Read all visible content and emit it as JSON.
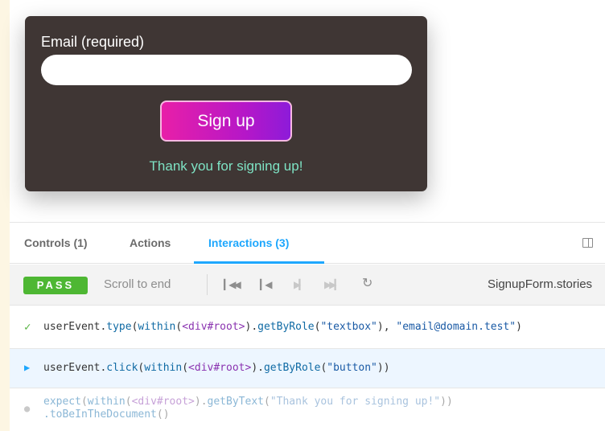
{
  "form": {
    "email_label": "Email (required)",
    "email_value": "",
    "submit_label": "Sign up",
    "success_message": "Thank you for signing up!"
  },
  "panel": {
    "tabs": [
      {
        "label": "Controls (1)",
        "active": false
      },
      {
        "label": "Actions",
        "active": false
      },
      {
        "label": "Interactions (3)",
        "active": true
      }
    ],
    "toggle_icon": "panel-layout-icon"
  },
  "toolbar": {
    "status": "PASS",
    "scroll_label": "Scroll to end",
    "controls": [
      "rewind-to-start-icon",
      "step-back-icon",
      "step-forward-icon",
      "skip-to-end-icon",
      "reload-icon"
    ],
    "story_file": "SignupForm.stories"
  },
  "interactions": [
    {
      "status": "done",
      "parts": [
        {
          "t": "userEvent.",
          "c": "plain"
        },
        {
          "t": "type",
          "c": "fn"
        },
        {
          "t": "(",
          "c": "plain"
        },
        {
          "t": "within",
          "c": "fn"
        },
        {
          "t": "(",
          "c": "plain"
        },
        {
          "t": "<div#root>",
          "c": "el"
        },
        {
          "t": ").",
          "c": "plain"
        },
        {
          "t": "getByRole",
          "c": "fn"
        },
        {
          "t": "(",
          "c": "plain"
        },
        {
          "t": "\"textbox\"",
          "c": "str"
        },
        {
          "t": "), ",
          "c": "plain"
        },
        {
          "t": "\"email@domain.test\"",
          "c": "str"
        },
        {
          "t": ")",
          "c": "plain"
        }
      ]
    },
    {
      "status": "active",
      "parts": [
        {
          "t": "userEvent.",
          "c": "plain"
        },
        {
          "t": "click",
          "c": "fn"
        },
        {
          "t": "(",
          "c": "plain"
        },
        {
          "t": "within",
          "c": "fn"
        },
        {
          "t": "(",
          "c": "plain"
        },
        {
          "t": "<div#root>",
          "c": "el"
        },
        {
          "t": ").",
          "c": "plain"
        },
        {
          "t": "getByRole",
          "c": "fn"
        },
        {
          "t": "(",
          "c": "plain"
        },
        {
          "t": "\"button\"",
          "c": "str"
        },
        {
          "t": "))",
          "c": "plain"
        }
      ]
    },
    {
      "status": "pending",
      "parts": [
        {
          "t": "expect",
          "c": "fn"
        },
        {
          "t": "(",
          "c": "plain"
        },
        {
          "t": "within",
          "c": "fn"
        },
        {
          "t": "(",
          "c": "plain"
        },
        {
          "t": "<div#root>",
          "c": "el"
        },
        {
          "t": ").",
          "c": "plain"
        },
        {
          "t": "getByText",
          "c": "fn"
        },
        {
          "t": "(",
          "c": "plain"
        },
        {
          "t": "\"Thank you for signing up!\"",
          "c": "str"
        },
        {
          "t": "))",
          "c": "plain"
        }
      ],
      "parts2": [
        {
          "t": ".toBeInTheDocument",
          "c": "fn"
        },
        {
          "t": "()",
          "c": "plain"
        }
      ]
    }
  ]
}
